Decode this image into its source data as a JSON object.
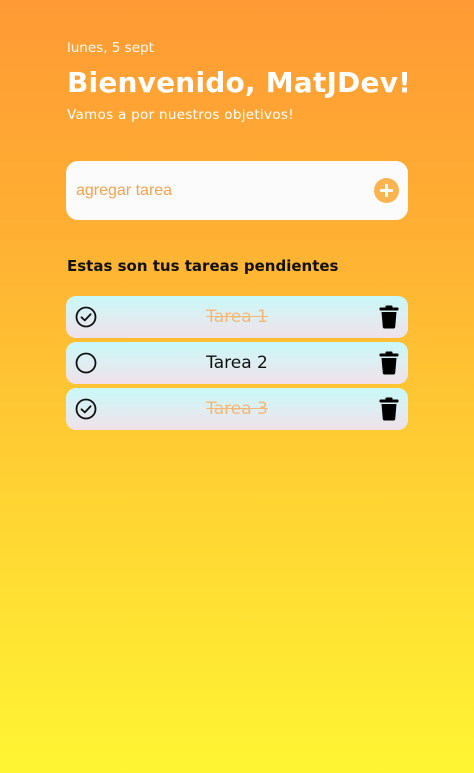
{
  "header": {
    "date": "lunes, 5 sept",
    "title": "Bienvenido, MatJDev!",
    "subtitle": "Vamos a por nuestros objetivos!"
  },
  "add_task": {
    "placeholder": "agregar tarea",
    "value": "",
    "button_icon": "plus-circle-icon"
  },
  "tasks_section": {
    "title": "Estas son tus tareas pendientes"
  },
  "tasks": [
    {
      "name": "Tarea 1",
      "completed": true
    },
    {
      "name": "Tarea 2",
      "completed": false
    },
    {
      "name": "Tarea 3",
      "completed": true
    }
  ],
  "icons": {
    "check": "check-circle-icon",
    "unchecked": "empty-circle-icon",
    "delete": "trash-icon"
  },
  "colors": {
    "gradient_top": "#ff9a34",
    "gradient_bottom": "#fff533",
    "accent": "#fbb450",
    "completed_text": "#f7b774"
  }
}
